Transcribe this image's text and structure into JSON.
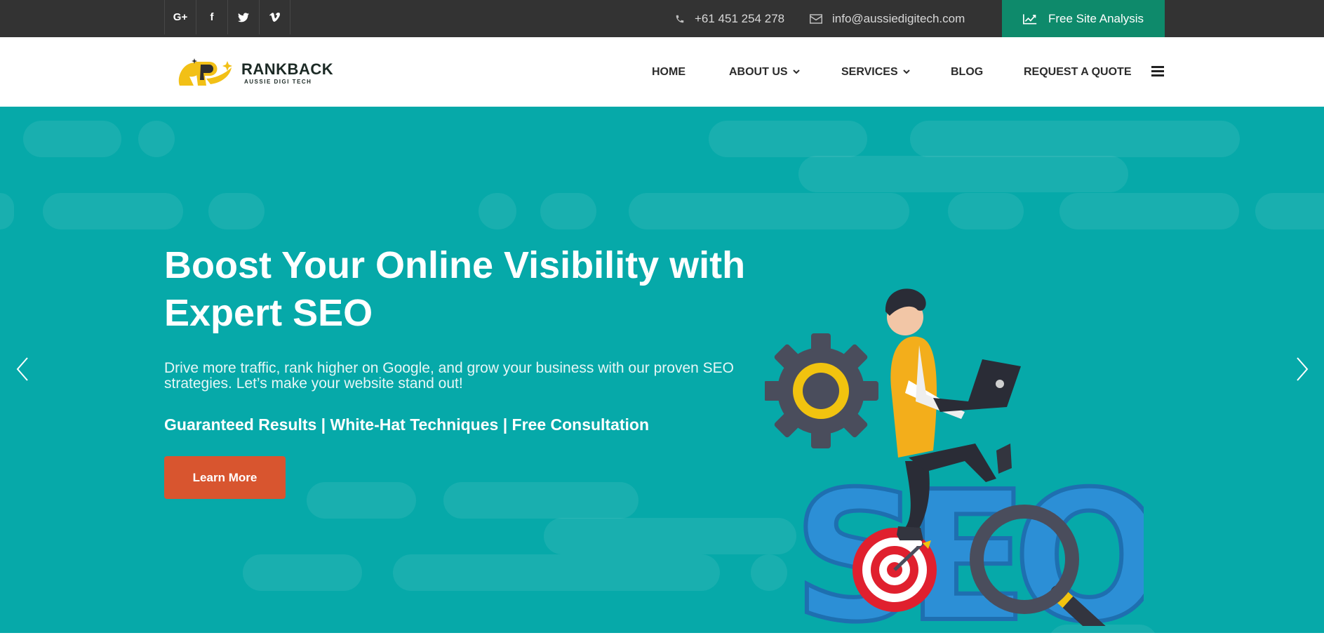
{
  "topbar": {
    "social": [
      {
        "name": "google-plus-icon",
        "glyph": "G+"
      },
      {
        "name": "facebook-icon",
        "glyph": "f"
      },
      {
        "name": "twitter-icon",
        "glyph": "t"
      },
      {
        "name": "vimeo-icon",
        "glyph": "v"
      }
    ],
    "phone": "+61 451 254 278",
    "email": "info@aussiedigitech.com",
    "cta_label": "Free Site Analysis",
    "cta_color": "#0e8a6b"
  },
  "header": {
    "logo_name": "RANKBACK",
    "logo_sub": "AUSSIE DIGI TECH",
    "nav": {
      "home": "HOME",
      "about": "ABOUT US",
      "services": "SERVICES",
      "blog": "BLOG",
      "quote": "REQUEST A QUOTE"
    }
  },
  "hero": {
    "title": "Boost Your Online Visibility with Expert SEO",
    "description": "Drive more traffic, rank higher on Google, and grow your business with our proven SEO strategies. Let’s make your website stand out!",
    "tagline": "Guaranteed Results | White-Hat Techniques | Free Consultation",
    "button_label": "Learn More",
    "background_color": "#06a9a9",
    "button_color": "#d8552f",
    "illustration_text": "SEO"
  }
}
